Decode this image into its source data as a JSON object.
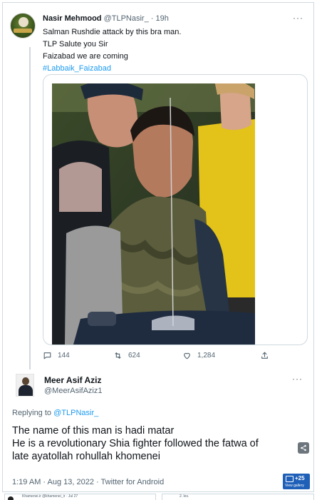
{
  "quoted_tweet": {
    "author_name": "Nasir Mehmood",
    "handle_time": "@TLPNasir_ · 19h",
    "lines": [
      "Salman Rushdie attack by this bra man.",
      "TLP Salute you Sir",
      "Faizabad we are coming"
    ],
    "hashtag": "#Labbaik_Faizabad",
    "stats": {
      "replies": "144",
      "retweets": "624",
      "likes": "1,284"
    }
  },
  "reply": {
    "author_name": "Meer Asif Aziz",
    "handle": "@MeerAsifAziz1",
    "replying_prefix": "Replying to",
    "replying_to": "@TLPNasir_",
    "text_lines": [
      "The name of this man is hadi matar",
      "He is a revolutionary Shia fighter followed the fatwa of",
      "late ayatollah rohullah khomenei"
    ],
    "meta": "1:19 AM · Aug 13, 2022 · Twitter for Android"
  },
  "gallery_badge": {
    "count": "+25",
    "label": "View gallery"
  },
  "footer_snippets": {
    "left": "Khamenei.ir @khamenei_ir · Jul 27",
    "right": "2. les."
  },
  "icons": {
    "reply": "comment-icon",
    "retweet": "retweet-icon",
    "like": "heart-icon",
    "share": "share-icon",
    "more": "more-icon"
  },
  "colors": {
    "link": "#1d9bf0",
    "secondary_text": "#536471",
    "border": "#cfd9de",
    "gallery_badge": "#1f5fb8"
  }
}
